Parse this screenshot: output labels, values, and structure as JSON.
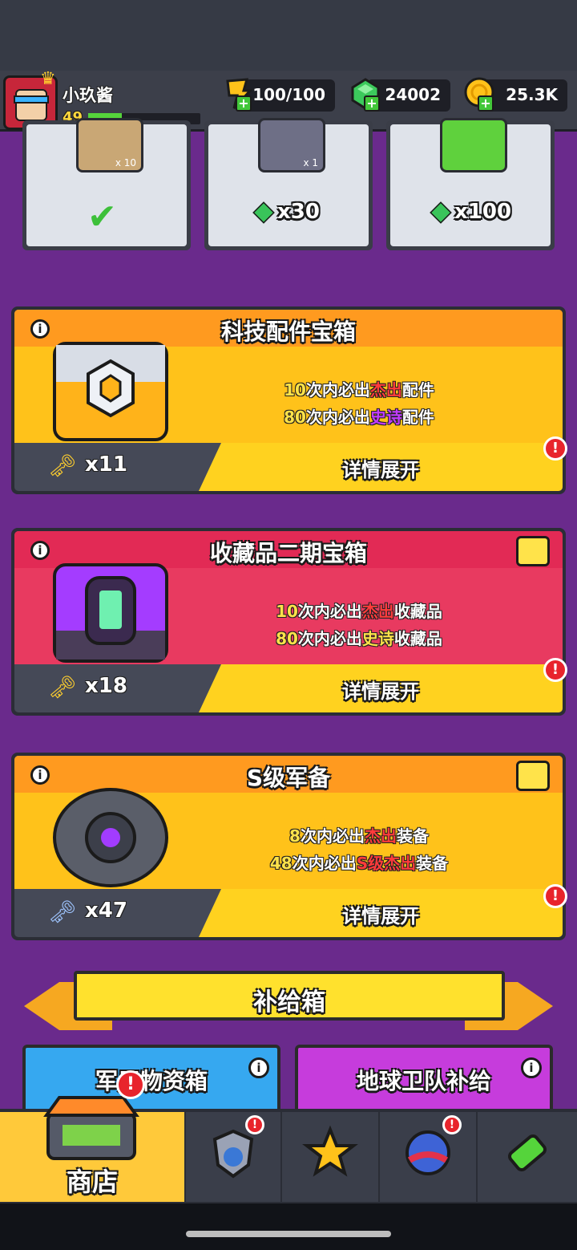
{
  "player": {
    "name": "小玖酱",
    "level": "49",
    "xp_fraction": 0.3
  },
  "resources": [
    {
      "name": "energy",
      "icon": "energy-card-icon",
      "value": "100/100"
    },
    {
      "name": "gems",
      "icon": "gem-icon",
      "value": "24002"
    },
    {
      "name": "gold",
      "icon": "gold-coin-icon",
      "value": "25.3K"
    }
  ],
  "top_cards": [
    {
      "count": "x 10",
      "claimed": true
    },
    {
      "count": "x 1",
      "price": "x30"
    },
    {
      "count": "",
      "price": "x100"
    }
  ],
  "chests": [
    {
      "title": "科技配件宝箱",
      "line1": {
        "n": "10",
        "a": "次内必出",
        "hl": "杰出",
        "b": "配件"
      },
      "line2": {
        "n": "80",
        "a": "次内必出",
        "hl": "史诗",
        "b": "配件"
      },
      "keys": "x11",
      "button": "详情展开"
    },
    {
      "title": "收藏品二期宝箱",
      "line1": {
        "n": "10",
        "a": "次内必出",
        "hl": "杰出",
        "b": "收藏品"
      },
      "line2": {
        "n": "80",
        "a": "次内必出",
        "hl": "史诗",
        "b": "收藏品"
      },
      "keys": "x18",
      "button": "详情展开"
    },
    {
      "title": "S级军备",
      "line1": {
        "n": "8",
        "a": "次内必出",
        "hl": "杰出",
        "b": "装备"
      },
      "line2": {
        "n": "48",
        "a": "次内必出",
        "hl": "S级杰出",
        "b": "装备"
      },
      "keys": "x47",
      "button": "详情展开"
    }
  ],
  "supply": {
    "banner": "补给箱",
    "left": "军用物资箱",
    "right": "地球卫队补给"
  },
  "nav": {
    "shop_label": "商店"
  },
  "colors": {
    "orange_header": "#ff9a1f",
    "red_header": "#e22a55",
    "purple_bg": "#6a2a8c",
    "button_yellow": "#ffd21f"
  }
}
